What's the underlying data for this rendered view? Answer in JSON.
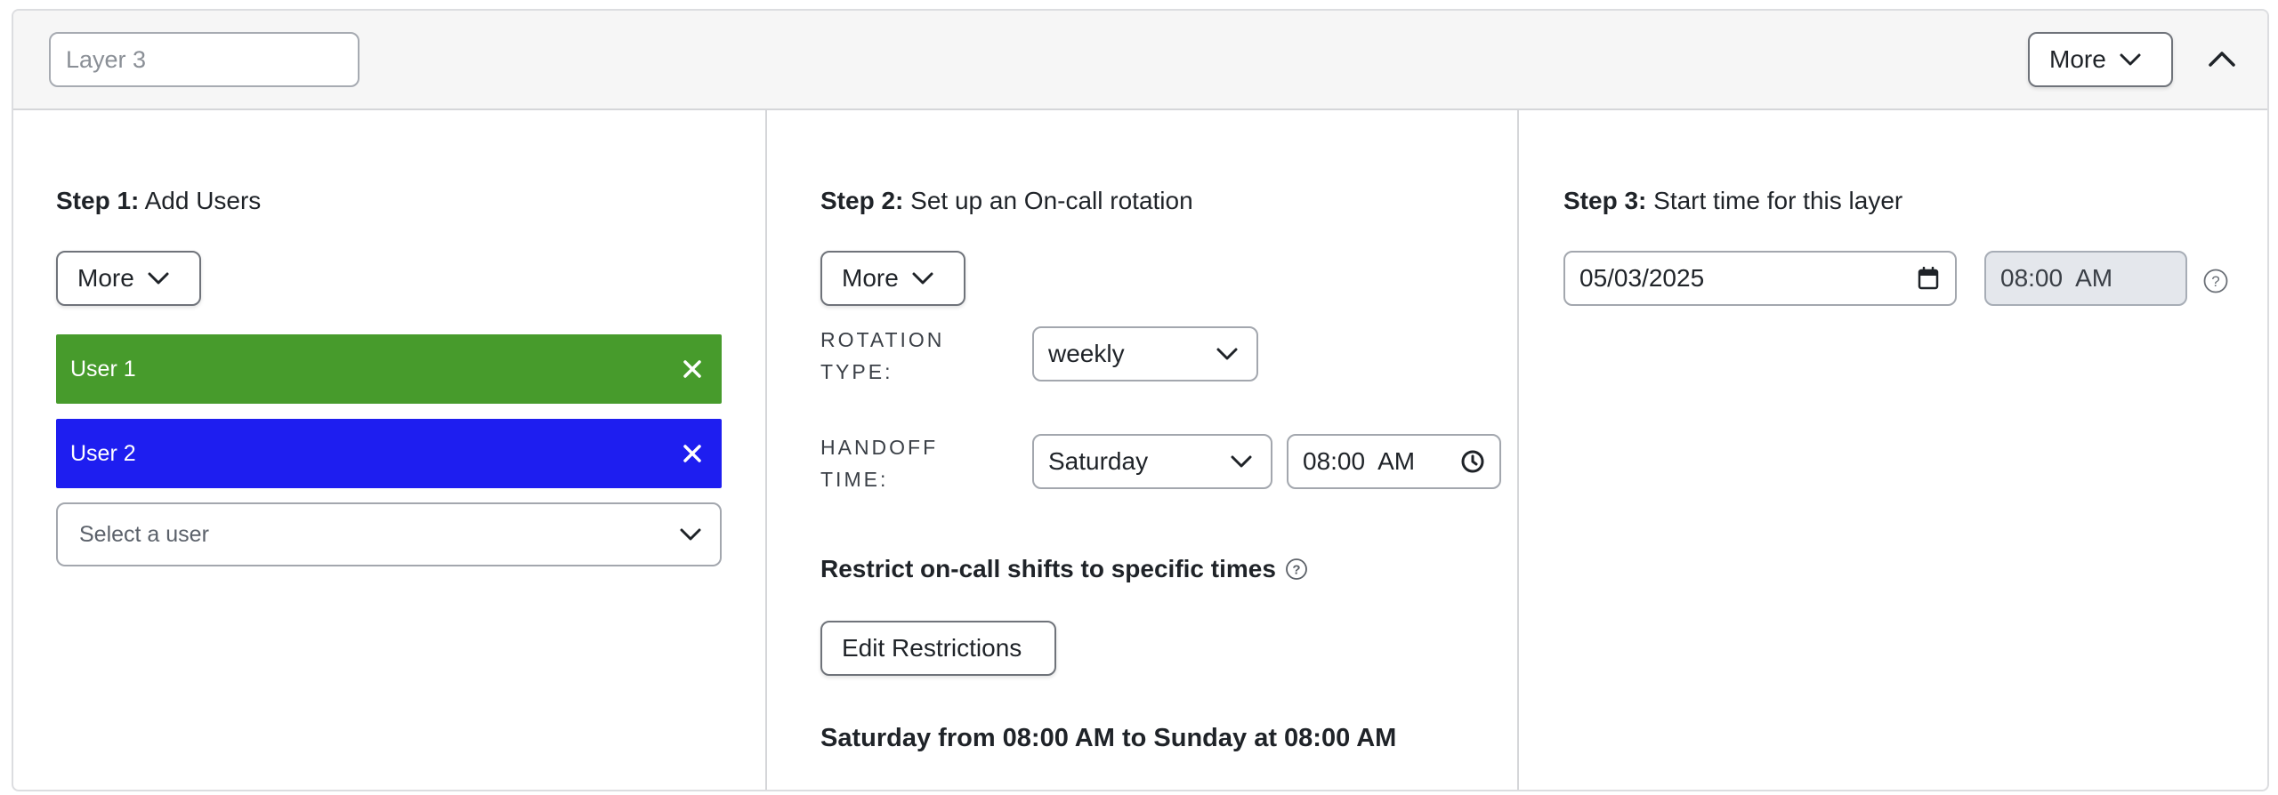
{
  "header": {
    "layer_placeholder": "Layer 3",
    "more_label": "More",
    "collapse_icon": "chevron-up-icon"
  },
  "step1": {
    "title_bold": "Step 1:",
    "title_rest": "Add Users",
    "more_label": "More",
    "users": [
      {
        "label": "User 1",
        "color": "#479b2c"
      },
      {
        "label": "User 2",
        "color": "#1e1ef0"
      }
    ],
    "select_placeholder": "Select a user"
  },
  "step2": {
    "title_bold": "Step 2:",
    "title_rest": "Set up an On-call rotation",
    "more_label": "More",
    "rotation_type_label": "ROTATION\nTYPE:",
    "rotation_type_value": "weekly",
    "handoff_label": "HANDOFF\nTIME:",
    "handoff_day": "Saturday",
    "handoff_time": "08:00  AM",
    "restrict_label": "Restrict on-call shifts to specific times",
    "edit_restrictions_label": "Edit Restrictions",
    "summary": "Saturday from 08:00 AM to Sunday at 08:00 AM"
  },
  "step3": {
    "title_bold": "Step 3:",
    "title_rest": "Start time for this layer",
    "start_date": "05/03/2025",
    "start_time": "08:00  AM"
  }
}
